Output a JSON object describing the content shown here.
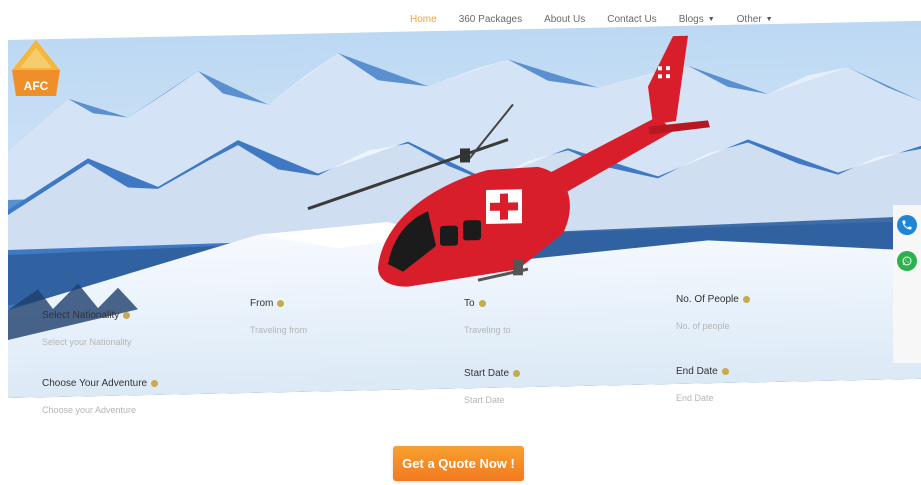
{
  "nav": {
    "items": [
      {
        "label": "Home",
        "active": true,
        "dropdown": false
      },
      {
        "label": "360 Packages",
        "active": false,
        "dropdown": false
      },
      {
        "label": "About Us",
        "active": false,
        "dropdown": false
      },
      {
        "label": "Contact Us",
        "active": false,
        "dropdown": false
      },
      {
        "label": "Blogs",
        "active": false,
        "dropdown": true
      },
      {
        "label": "Other",
        "active": false,
        "dropdown": true
      }
    ]
  },
  "logo": {
    "text": "AFC"
  },
  "form": {
    "fields": [
      {
        "key": "nationality",
        "label": "Select Nationality",
        "placeholder": "Select your Nationality"
      },
      {
        "key": "from",
        "label": "From",
        "placeholder": "Traveling from"
      },
      {
        "key": "to",
        "label": "To",
        "placeholder": "Traveling to"
      },
      {
        "key": "people",
        "label": "No. Of People",
        "placeholder": "No. of people"
      },
      {
        "key": "adventure",
        "label": "Choose Your Adventure",
        "placeholder": "Choose your Adventure"
      },
      {
        "key": "start",
        "label": "Start Date",
        "placeholder": "Start Date"
      },
      {
        "key": "end",
        "label": "End Date",
        "placeholder": "End Date"
      }
    ]
  },
  "cta": {
    "label": "Get a Quote Now !"
  },
  "icons": {
    "info": "info-icon",
    "phone": "phone-icon",
    "whatsapp": "whatsapp-icon",
    "caret": "chevron-down-icon"
  },
  "colors": {
    "accent": "#f2a23a",
    "cta_top": "#f7a030",
    "cta_bottom": "#f27a1f",
    "helicopter_red": "#d81e2a",
    "phone": "#1f86d6",
    "whatsapp": "#2bb24c"
  }
}
